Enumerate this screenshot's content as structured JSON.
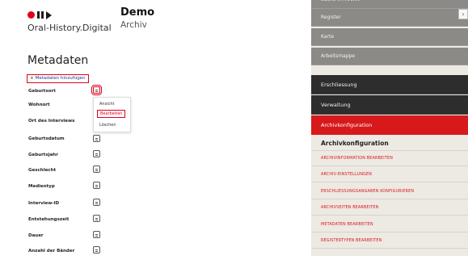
{
  "brand": {
    "subtitle": "Oral-History.Digital"
  },
  "project": {
    "title": "Demo",
    "subtitle": "Archiv"
  },
  "page_title": "Metadaten",
  "add_button": {
    "label": "Metadaten hinzufügen"
  },
  "fields": [
    {
      "label": "Geburtsort"
    },
    {
      "label": "Wohnort"
    },
    {
      "label": "Ort des Interviews"
    },
    {
      "label": "Geburtsdatum"
    },
    {
      "label": "Geburtsjahr"
    },
    {
      "label": "Geschlecht"
    },
    {
      "label": "Medientyp"
    },
    {
      "label": "Interview-ID"
    },
    {
      "label": "Entstehungszeit"
    },
    {
      "label": "Dauer"
    },
    {
      "label": "Anzahl der Bänder"
    }
  ],
  "dropdown": {
    "items": [
      "Ansicht",
      "Bearbeiten",
      "Löschen"
    ],
    "selected": "Bearbeiten"
  },
  "sidebar": {
    "items": [
      {
        "label": "Suche im Archiv",
        "style": "gray"
      },
      {
        "label": "Register",
        "style": "gray"
      },
      {
        "label": "Karte",
        "style": "gray"
      },
      {
        "label": "Arbeitsmappe",
        "style": "gray"
      },
      {
        "label": "Erschliessung",
        "style": "dark"
      },
      {
        "label": "Verwaltung",
        "style": "dark"
      },
      {
        "label": "Archivkonfiguration",
        "style": "red"
      }
    ],
    "section_title": "Archivkonfiguration",
    "sublinks": [
      "ARCHIVINFORMATION BEARBEITEN",
      "ARCHIV-EINSTELLUNGEN",
      "ERSCHLIESSUNGSANGABEN KONFIGURIEREN",
      "ARCHIVSEITEN BEARBEITEN",
      "METADATEN BEARBEITEN",
      "REGISTERTYPEN BEARBEITEN"
    ],
    "corner_icon": "collapse-icon"
  },
  "colors": {
    "accent_red": "#e3001b",
    "sidebar_gray": "#8b8a87",
    "sidebar_dark": "#2d2d2d",
    "sidebar_bg": "#ede9e3"
  }
}
